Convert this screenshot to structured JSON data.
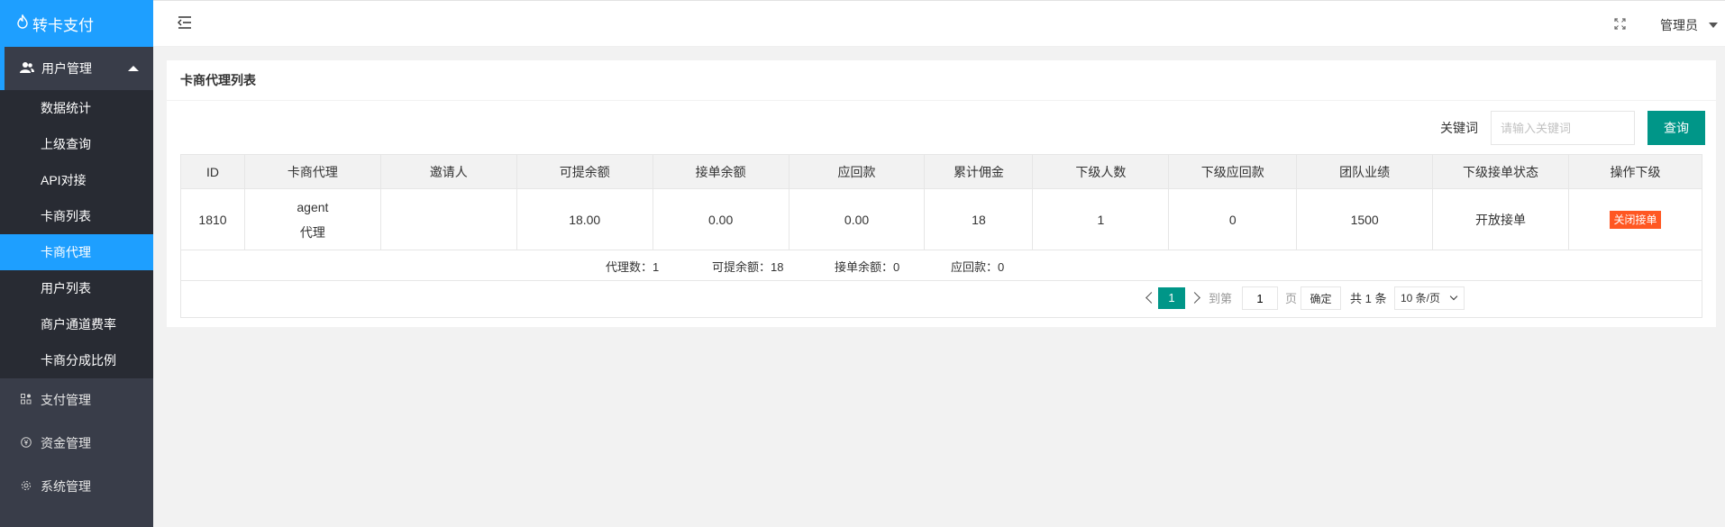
{
  "app": {
    "title": "转卡支付"
  },
  "sidebar": {
    "user_mgmt": {
      "label": "用户管理"
    },
    "sub_items": [
      {
        "label": "数据统计"
      },
      {
        "label": "上级查询"
      },
      {
        "label": "API对接"
      },
      {
        "label": "卡商列表"
      },
      {
        "label": "卡商代理"
      },
      {
        "label": "用户列表"
      },
      {
        "label": "商户通道费率"
      },
      {
        "label": "卡商分成比例"
      }
    ],
    "groups": [
      {
        "label": "支付管理",
        "icon": "payment-icon"
      },
      {
        "label": "资金管理",
        "icon": "yuan-icon"
      },
      {
        "label": "系统管理",
        "icon": "gear-icon"
      }
    ]
  },
  "header": {
    "user": "管理员"
  },
  "page": {
    "title": "卡商代理列表",
    "search": {
      "label": "关键词",
      "placeholder": "请输入关键词",
      "button": "查询"
    },
    "table": {
      "columns": [
        "ID",
        "卡商代理",
        "邀请人",
        "可提余额",
        "接单余额",
        "应回款",
        "累计佣金",
        "下级人数",
        "下级应回款",
        "团队业绩",
        "下级接单状态",
        "操作下级"
      ],
      "rows": [
        {
          "id": "1810",
          "agent_line1": "agent",
          "agent_line2": "代理",
          "inviter": "",
          "withdrawable": "18.00",
          "order_balance": "0.00",
          "receivable": "0.00",
          "commission": "18",
          "sub_count": "1",
          "sub_receivable": "0",
          "team_perf": "1500",
          "sub_status": "开放接单",
          "action": "关闭接单"
        }
      ]
    },
    "summary": {
      "agents": "代理数：1",
      "withdrawable": "可提余额：18",
      "order_balance": "接单余额：0",
      "receivable": "应回款：0"
    },
    "pager": {
      "current": "1",
      "goto_label": "到第",
      "goto_value": "1",
      "page_unit": "页",
      "confirm": "确定",
      "total": "共 1 条",
      "limit": "10 条/页"
    }
  },
  "colors": {
    "accent": "#1e9fff",
    "primary_green": "#009688",
    "danger": "#ff5722",
    "sidebar_bg": "#393d49",
    "submenu_bg": "#282b33"
  }
}
